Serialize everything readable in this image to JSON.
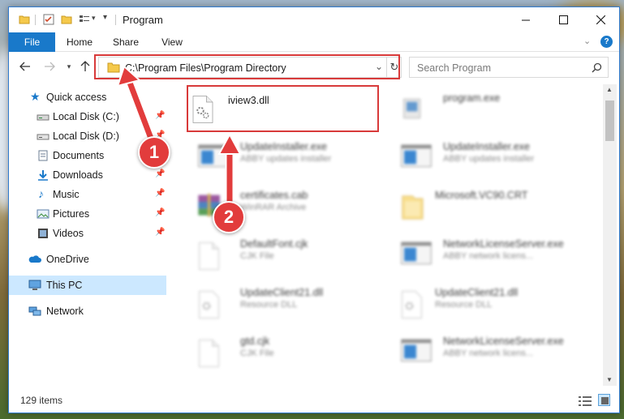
{
  "window": {
    "title": "Program",
    "controls": [
      "minimize",
      "maximize",
      "close"
    ]
  },
  "ribbon": {
    "tabs": [
      "File",
      "Home",
      "Share",
      "View"
    ]
  },
  "address_bar": {
    "path": "C:\\Program Files\\Program Directory"
  },
  "search": {
    "placeholder": "Search Program"
  },
  "nav_pane": {
    "items": [
      {
        "label": "Quick access",
        "icon": "star-icon",
        "pinned": false
      },
      {
        "label": "Local Disk (C:)",
        "icon": "drive-icon",
        "pinned": true
      },
      {
        "label": "Local Disk (D:)",
        "icon": "drive-icon",
        "pinned": true
      },
      {
        "label": "Documents",
        "icon": "documents-icon",
        "pinned": true
      },
      {
        "label": "Downloads",
        "icon": "download-icon",
        "pinned": true
      },
      {
        "label": "Music",
        "icon": "music-icon",
        "pinned": true
      },
      {
        "label": "Pictures",
        "icon": "pictures-icon",
        "pinned": true
      },
      {
        "label": "Videos",
        "icon": "videos-icon",
        "pinned": true
      },
      {
        "label": "OneDrive",
        "icon": "cloud-icon",
        "pinned": false
      },
      {
        "label": "This PC",
        "icon": "computer-icon",
        "pinned": false,
        "selected": true
      },
      {
        "label": "Network",
        "icon": "network-icon",
        "pinned": false
      }
    ]
  },
  "files": [
    {
      "name": "iview3.dll",
      "desc": "",
      "icon": "dll-gear-icon",
      "highlighted": true
    },
    {
      "name": "program.exe",
      "desc": "",
      "icon": "exe-icon"
    },
    {
      "name": "UpdateInstaller.exe",
      "desc": "ABBY updates installer",
      "icon": "app-window-icon"
    },
    {
      "name": "UpdateInstaller.exe",
      "desc": "ABBY updates installer",
      "icon": "app-window-icon"
    },
    {
      "name": "certificates.cab",
      "desc": "WinRAR Archive",
      "icon": "archive-icon"
    },
    {
      "name": "Microsoft.VC90.CRT",
      "desc": "",
      "icon": "folder-icon"
    },
    {
      "name": "DefaultFont.cjk",
      "desc": "CJK File",
      "icon": "blank-file-icon"
    },
    {
      "name": "NetworkLicenseServer.exe",
      "desc": "ABBY network licens...",
      "icon": "app-window-icon"
    },
    {
      "name": "UpdateClient21.dll",
      "desc": "Resource DLL",
      "icon": "dll-gear-icon"
    },
    {
      "name": "UpdateClient21.dll",
      "desc": "Resource DLL",
      "icon": "dll-gear-icon"
    },
    {
      "name": "gtd.cjk",
      "desc": "CJK File",
      "icon": "blank-file-icon"
    },
    {
      "name": "NetworkLicenseServer.exe",
      "desc": "ABBY network licens...",
      "icon": "app-window-icon"
    }
  ],
  "status": {
    "item_count": "129 items"
  },
  "annotations": {
    "badge1": "1",
    "badge2": "2",
    "color": "#d83a3a"
  },
  "colors": {
    "accent": "#1979ca",
    "selection": "#cce8ff"
  }
}
